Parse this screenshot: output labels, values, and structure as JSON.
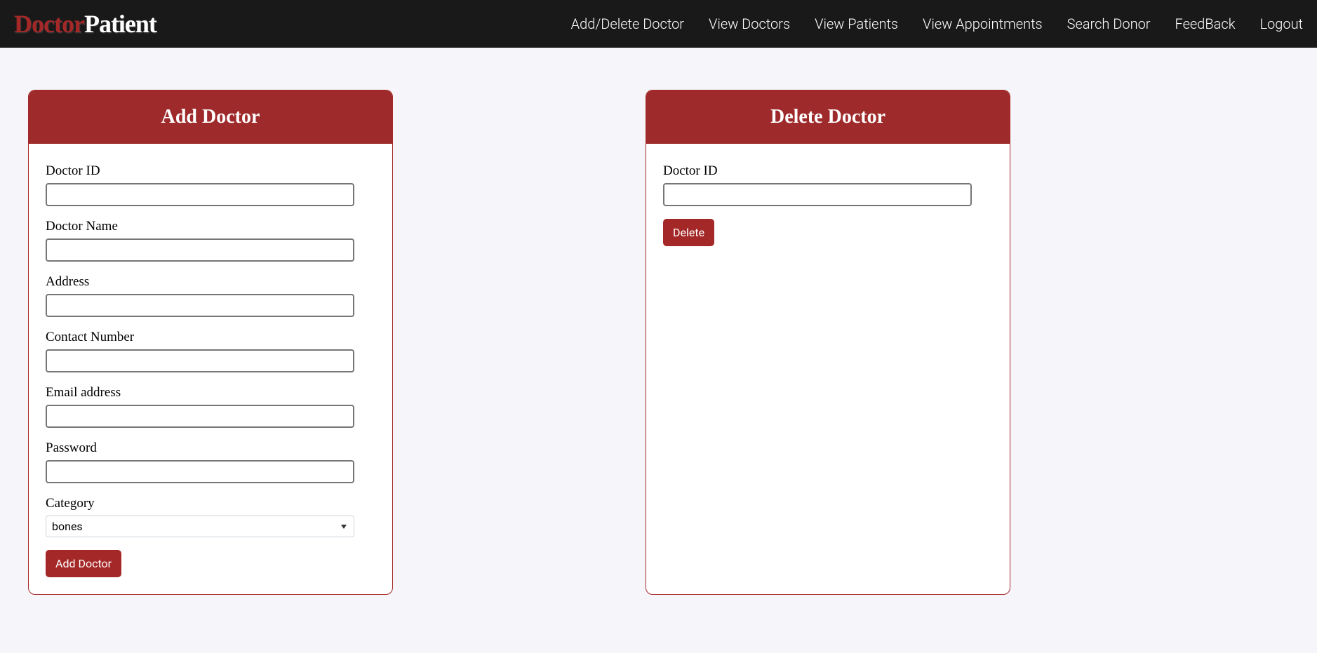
{
  "logo": {
    "part1": "Doctor",
    "part2": "Patient"
  },
  "nav": {
    "items": [
      "Add/Delete Doctor",
      "View Doctors",
      "View Patients",
      "View Appointments",
      "Search Donor",
      "FeedBack",
      "Logout"
    ]
  },
  "add_card": {
    "title": "Add Doctor",
    "fields": {
      "doctor_id": {
        "label": "Doctor ID",
        "value": ""
      },
      "doctor_name": {
        "label": "Doctor Name",
        "value": ""
      },
      "address": {
        "label": "Address",
        "value": ""
      },
      "contact": {
        "label": "Contact Number",
        "value": ""
      },
      "email": {
        "label": "Email address",
        "value": ""
      },
      "password": {
        "label": "Password",
        "value": ""
      },
      "category": {
        "label": "Category",
        "selected": "bones"
      }
    },
    "submit_label": "Add Doctor"
  },
  "delete_card": {
    "title": "Delete Doctor",
    "fields": {
      "doctor_id": {
        "label": "Doctor ID",
        "value": ""
      }
    },
    "submit_label": "Delete"
  }
}
